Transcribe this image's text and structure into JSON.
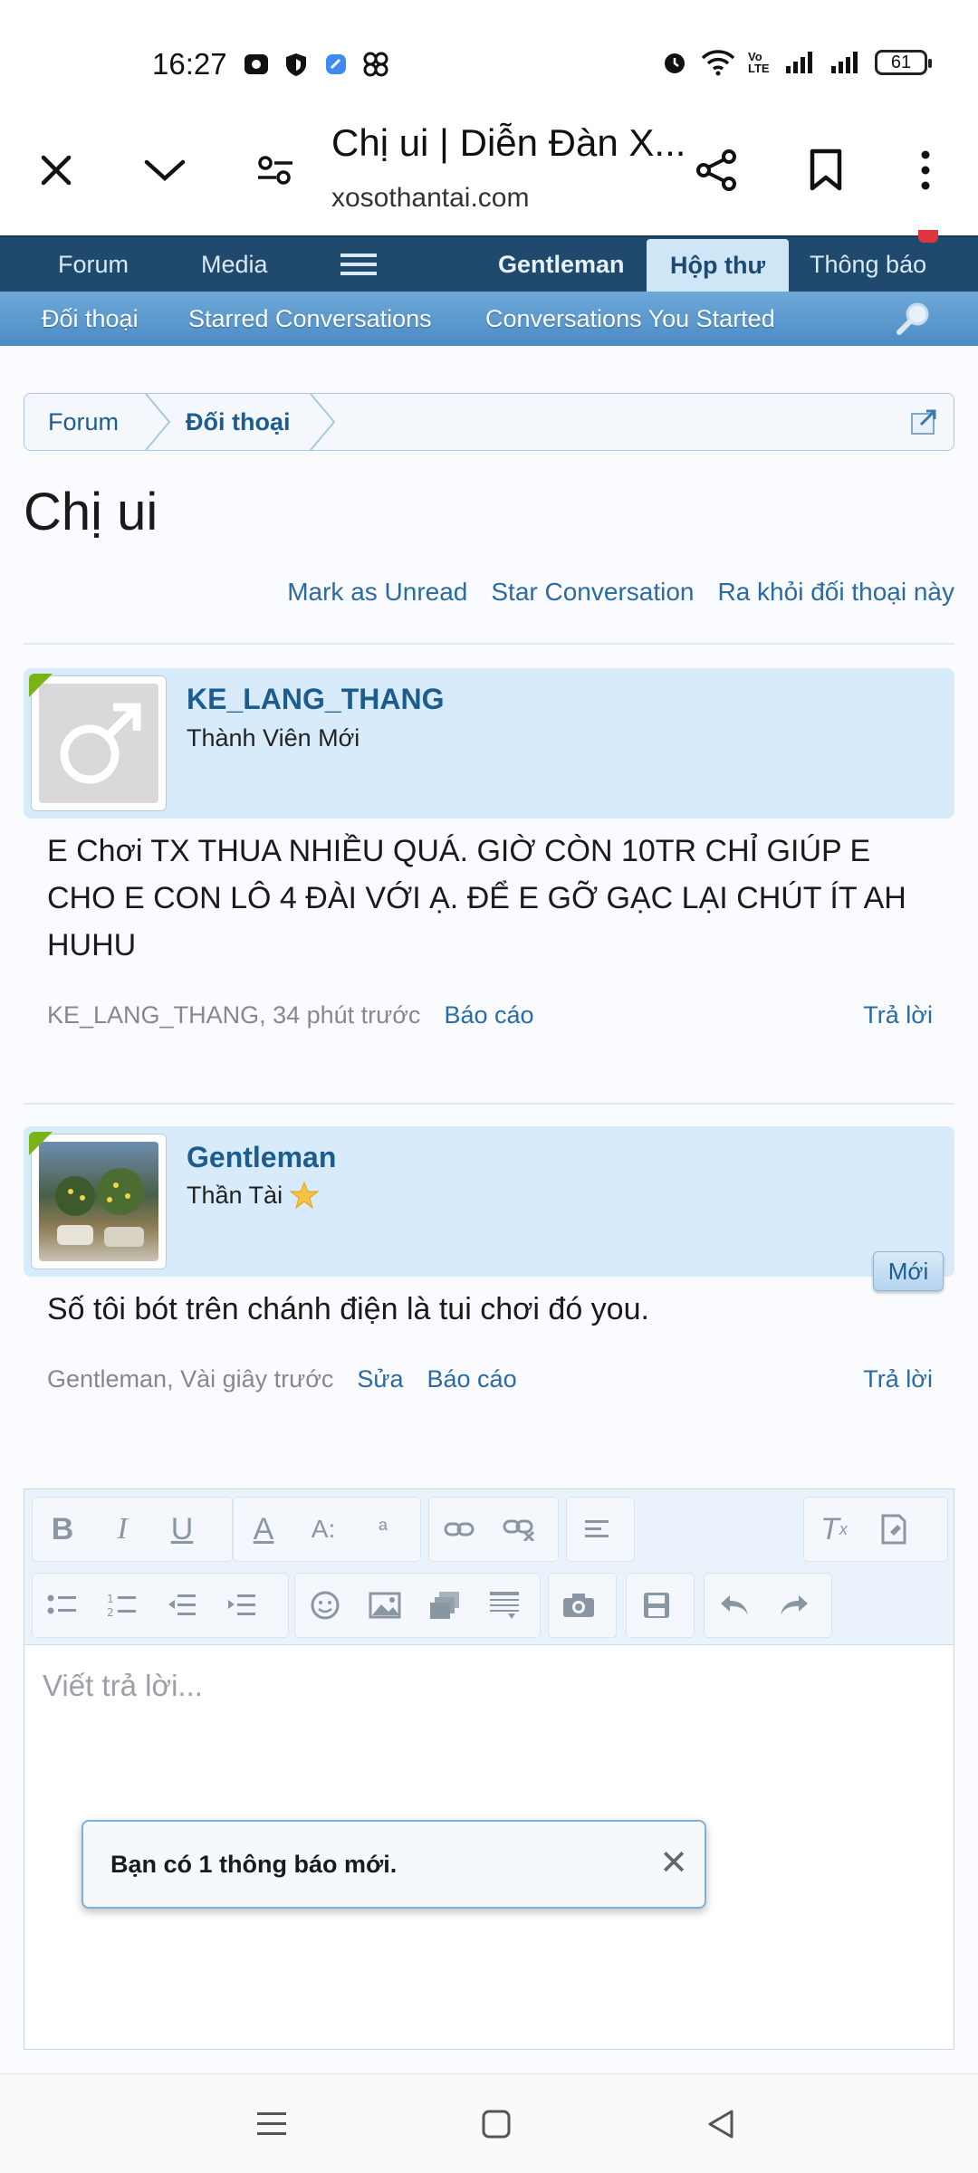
{
  "status_bar": {
    "time": "16:27",
    "battery": "61",
    "volte": "Vo LTE"
  },
  "browser": {
    "title": "Chị ui | Diễn Đàn X...",
    "url": "xosothantai.com"
  },
  "forum_nav": {
    "items": [
      "Forum",
      "Media"
    ],
    "user": "Gentleman",
    "inbox": "Hộp thư",
    "alerts": "Thông báo"
  },
  "sub_nav": {
    "items": [
      "Đối thoại",
      "Starred Conversations",
      "Conversations You Started"
    ]
  },
  "breadcrumb": [
    "Forum",
    "Đối thoại"
  ],
  "page_title": "Chị ui",
  "actions": [
    "Mark as Unread",
    "Star Conversation",
    "Ra khỏi đối thoại này"
  ],
  "posts": [
    {
      "username": "KE_LANG_THANG",
      "user_title": "Thành Viên Mới",
      "message": "E Chơi TX THUA NHIỀU QUÁ. GIỜ CÒN 10TR CHỈ GIÚP E CHO E CON LÔ 4 ĐÀI VỚI Ạ. ĐỂ E GỠ GẠC LẠI CHÚT ÍT AH HUHU",
      "meta": "KE_LANG_THANG, 34 phút trước",
      "report": "Báo cáo",
      "reply": "Trả lời"
    },
    {
      "username": "Gentleman",
      "user_title": "Thần Tài",
      "message": "Số tôi bót trên chánh điện là tui chơi đó you.",
      "meta": "Gentleman, Vài giây trước",
      "edit": "Sửa",
      "report": "Báo cáo",
      "reply": "Trả lời",
      "badge": "Mới"
    }
  ],
  "editor": {
    "placeholder": "Viết trả lời..."
  },
  "toast": {
    "text": "Bạn có 1 thông báo mới."
  },
  "colors": {
    "nav_dark": "#1f4a6d",
    "nav_light": "#5a9ad0",
    "link": "#2b6aa3",
    "post_head_bg": "#d7ebfa"
  }
}
